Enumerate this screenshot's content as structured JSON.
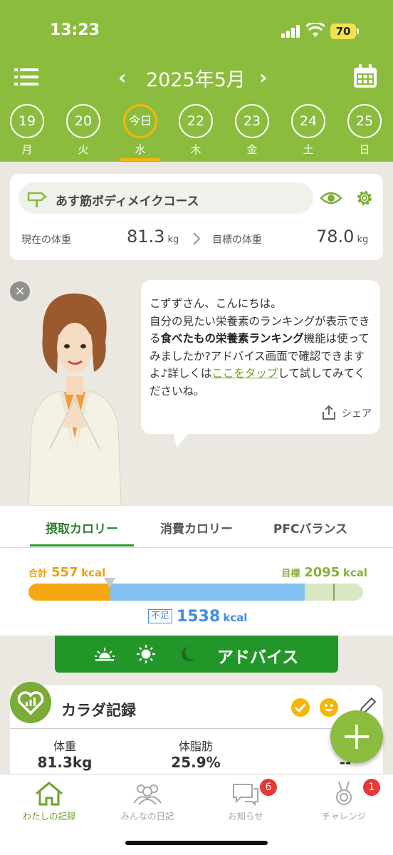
{
  "status": {
    "time": "13:23",
    "battery": "70"
  },
  "header": {
    "month_title": "2025年5月",
    "prev": "‹",
    "next": "›",
    "days": [
      {
        "num": "19",
        "dow": "月"
      },
      {
        "num": "20",
        "dow": "火"
      },
      {
        "num": "今日",
        "dow": "水"
      },
      {
        "num": "22",
        "dow": "木"
      },
      {
        "num": "23",
        "dow": "金"
      },
      {
        "num": "24",
        "dow": "土"
      },
      {
        "num": "25",
        "dow": "日"
      }
    ]
  },
  "course": {
    "name": "あす筋ボディメイクコース",
    "current_label": "現在の体重",
    "current_value": "81.3",
    "goal_label": "目標の体重",
    "goal_value": "78.0",
    "unit": "kg"
  },
  "advice": {
    "line1": "こずずさん、こんにちは。",
    "line2": "自分の見たい栄養素のランキングが表示できる",
    "bold": "食べたもの栄養素ランキング",
    "line3": "機能は使ってみましたか?アドバイス画面で確認できますよ♪詳しくは",
    "link": "ここをタップ",
    "line4": "して試してみてくださいね。",
    "share": "シェア",
    "close": "×"
  },
  "calorie": {
    "tabs": [
      "摂取カロリー",
      "消費カロリー",
      "PFCバランス"
    ],
    "total_label": "合計",
    "total_value": "557",
    "goal_label": "目標",
    "goal_value": "2095",
    "unit": "kcal",
    "shortage_label": "不足",
    "shortage_value": "1538",
    "intake_fraction": 0.2659,
    "colors": {
      "intake": "#f5a80f",
      "shortage": "#82c0f1",
      "track": "#d8e8c3"
    }
  },
  "advice_button": {
    "label": "アドバイス",
    "icons": [
      "sunrise-icon",
      "sun-icon",
      "moon-icon"
    ]
  },
  "body_record": {
    "title": "カラダ記録",
    "metrics": [
      {
        "label": "体重",
        "value": "81.3kg"
      },
      {
        "label": "体脂肪",
        "value": "25.9%"
      },
      {
        "label": "",
        "value": "--"
      }
    ]
  },
  "nav": {
    "items": [
      {
        "label": "わたしの記録",
        "icon": "home-icon"
      },
      {
        "label": "みんなの日記",
        "icon": "people-icon"
      },
      {
        "label": "お知らせ",
        "icon": "chat-icon",
        "badge": "6"
      },
      {
        "label": "チャレンジ",
        "icon": "medal-icon",
        "badge": "1"
      }
    ]
  },
  "theme": {
    "primary": "#8bbc3e",
    "accent": "#f5b60a",
    "button": "#229629"
  }
}
